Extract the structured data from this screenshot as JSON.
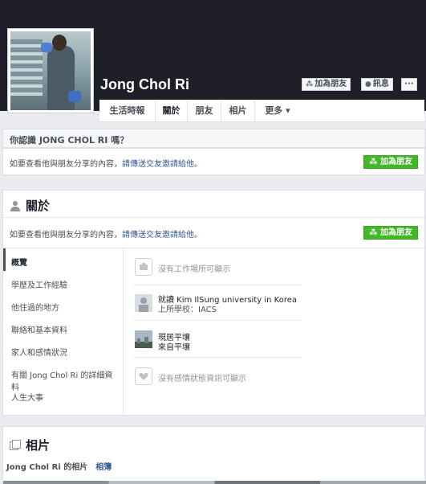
{
  "profile": {
    "name": "Jong Chol Ri",
    "buttons": {
      "add_friend": "加為朋友",
      "message": "訊息",
      "more": "···"
    }
  },
  "tabs": [
    {
      "label": "生活時報"
    },
    {
      "label": "關於"
    },
    {
      "label": "朋友"
    },
    {
      "label": "相片"
    },
    {
      "label": "更多 ▾"
    }
  ],
  "know_box": {
    "heading": "你認識 JONG CHOL RI 嗎？",
    "text": "如要查看他與朋友分享的內容，",
    "link": "請傳送交友邀請給他",
    "after": "。",
    "button": "加為朋友"
  },
  "about": {
    "title": "關於",
    "notice_text": "如要查看他與朋友分享的內容，",
    "notice_link": "請傳送交友邀請給他",
    "notice_after": "。",
    "button": "加為朋友",
    "sidebar": [
      "概覽",
      "學歷及工作經驗",
      "他住過的地方",
      "聯絡和基本資料",
      "家人和感情狀況",
      "有關 Jong Chol Ri 的詳細資料",
      "人生大事"
    ],
    "rows": [
      {
        "icon": "briefcase-icon",
        "line1": "沒有工作場所可顯示",
        "line2": ""
      },
      {
        "icon": "school-icon",
        "line1": "就讀 Kim IlSung university in Korea",
        "line2": "上所學校：IACS"
      },
      {
        "icon": "city-icon",
        "line1": "現居平壤",
        "line2": "來自平壤"
      },
      {
        "icon": "heart-icon",
        "line1": "沒有感情狀態資訊可顯示",
        "line2": ""
      }
    ]
  },
  "photos": {
    "title": "相片",
    "sub": "Jong Chol Ri 的相片",
    "albums": "相簿"
  }
}
